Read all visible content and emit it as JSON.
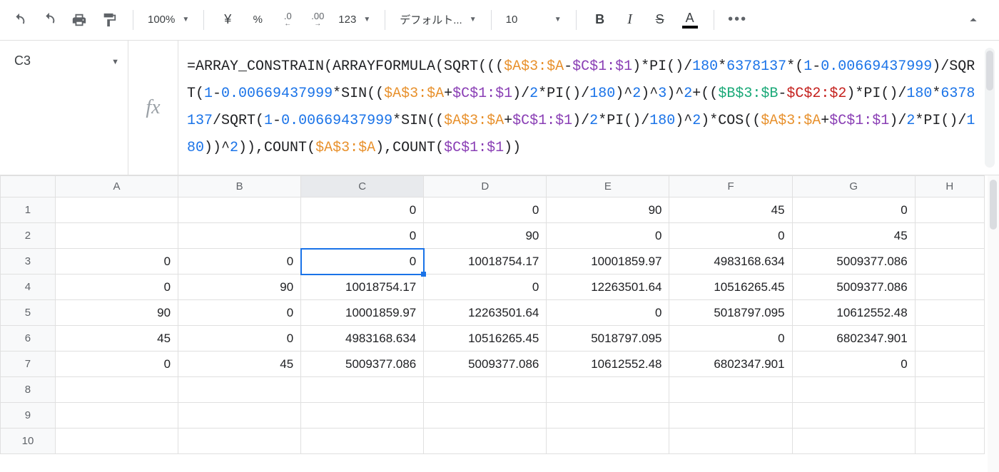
{
  "toolbar": {
    "zoom": "100%",
    "currency_symbol": "¥",
    "percent_label": "%",
    "dec_decrease": ".0",
    "dec_increase": ".00",
    "format_more": "123",
    "font_name": "デフォルト...",
    "font_size": "10",
    "bold": "B",
    "italic": "I",
    "strike": "S",
    "textcolor_letter": "A"
  },
  "namebox": {
    "cell_ref": "C3"
  },
  "fx_label": "fx",
  "formula_tokens": [
    {
      "t": "fn",
      "v": "=ARRAY_CONSTRAIN(ARRAYFORMULA(SQRT((("
    },
    {
      "t": "rngA",
      "v": "$A$3:$A"
    },
    {
      "t": "fn",
      "v": "-"
    },
    {
      "t": "rngC1",
      "v": "$C$1:$1"
    },
    {
      "t": "fn",
      "v": ")*PI()/"
    },
    {
      "t": "num",
      "v": "180"
    },
    {
      "t": "fn",
      "v": "*"
    },
    {
      "t": "num",
      "v": "6378137"
    },
    {
      "t": "fn",
      "v": "*("
    },
    {
      "t": "num",
      "v": "1"
    },
    {
      "t": "fn",
      "v": "-"
    },
    {
      "t": "num",
      "v": "0.00669437999"
    },
    {
      "t": "fn",
      "v": ")/SQRT("
    },
    {
      "t": "num",
      "v": "1"
    },
    {
      "t": "fn",
      "v": "-"
    },
    {
      "t": "num",
      "v": "0.00669437999"
    },
    {
      "t": "fn",
      "v": "*SIN(("
    },
    {
      "t": "rngA",
      "v": "$A$3:$A"
    },
    {
      "t": "fn",
      "v": "+"
    },
    {
      "t": "rngC1",
      "v": "$C$1:$1"
    },
    {
      "t": "fn",
      "v": ")/"
    },
    {
      "t": "num",
      "v": "2"
    },
    {
      "t": "fn",
      "v": "*PI()/"
    },
    {
      "t": "num",
      "v": "180"
    },
    {
      "t": "fn",
      "v": ")^"
    },
    {
      "t": "num",
      "v": "2"
    },
    {
      "t": "fn",
      "v": ")^"
    },
    {
      "t": "num",
      "v": "3"
    },
    {
      "t": "fn",
      "v": ")^"
    },
    {
      "t": "num",
      "v": "2"
    },
    {
      "t": "fn",
      "v": "+(("
    },
    {
      "t": "rngB",
      "v": "$B$3:$B"
    },
    {
      "t": "fn",
      "v": "-"
    },
    {
      "t": "rngC2",
      "v": "$C$2:$2"
    },
    {
      "t": "fn",
      "v": ")*PI()/"
    },
    {
      "t": "num",
      "v": "180"
    },
    {
      "t": "fn",
      "v": "*"
    },
    {
      "t": "num",
      "v": "6378137"
    },
    {
      "t": "fn",
      "v": "/SQRT("
    },
    {
      "t": "num",
      "v": "1"
    },
    {
      "t": "fn",
      "v": "-"
    },
    {
      "t": "num",
      "v": "0.00669437999"
    },
    {
      "t": "fn",
      "v": "*SIN(("
    },
    {
      "t": "rngA",
      "v": "$A$3:$A"
    },
    {
      "t": "fn",
      "v": "+"
    },
    {
      "t": "rngC1",
      "v": "$C$1:$1"
    },
    {
      "t": "fn",
      "v": ")/"
    },
    {
      "t": "num",
      "v": "2"
    },
    {
      "t": "fn",
      "v": "*PI()/"
    },
    {
      "t": "num",
      "v": "180"
    },
    {
      "t": "fn",
      "v": ")^"
    },
    {
      "t": "num",
      "v": "2"
    },
    {
      "t": "fn",
      "v": ")*COS(("
    },
    {
      "t": "rngA",
      "v": "$A$3:$A"
    },
    {
      "t": "fn",
      "v": "+"
    },
    {
      "t": "rngC1",
      "v": "$C$1:$1"
    },
    {
      "t": "fn",
      "v": ")/"
    },
    {
      "t": "num",
      "v": "2"
    },
    {
      "t": "fn",
      "v": "*PI()/"
    },
    {
      "t": "num",
      "v": "180"
    },
    {
      "t": "fn",
      "v": "))^"
    },
    {
      "t": "num",
      "v": "2"
    },
    {
      "t": "fn",
      "v": ")),COUNT("
    },
    {
      "t": "rngA",
      "v": "$A$3:$A"
    },
    {
      "t": "fn",
      "v": "),COUNT("
    },
    {
      "t": "rngC1",
      "v": "$C$1:$1"
    },
    {
      "t": "fn",
      "v": "))"
    }
  ],
  "grid": {
    "columns": [
      "A",
      "B",
      "C",
      "D",
      "E",
      "F",
      "G",
      "H"
    ],
    "row_labels": [
      "1",
      "2",
      "3",
      "4",
      "5",
      "6",
      "7",
      "8",
      "9",
      "10"
    ],
    "selected_cell": "C3",
    "rows": [
      {
        "A": "",
        "B": "",
        "C": "0",
        "D": "0",
        "E": "90",
        "F": "45",
        "G": "0",
        "H": ""
      },
      {
        "A": "",
        "B": "",
        "C": "0",
        "D": "90",
        "E": "0",
        "F": "0",
        "G": "45",
        "H": ""
      },
      {
        "A": "0",
        "B": "0",
        "C": "0",
        "D": "10018754.17",
        "E": "10001859.97",
        "F": "4983168.634",
        "G": "5009377.086",
        "H": ""
      },
      {
        "A": "0",
        "B": "90",
        "C": "10018754.17",
        "D": "0",
        "E": "12263501.64",
        "F": "10516265.45",
        "G": "5009377.086",
        "H": ""
      },
      {
        "A": "90",
        "B": "0",
        "C": "10001859.97",
        "D": "12263501.64",
        "E": "0",
        "F": "5018797.095",
        "G": "10612552.48",
        "H": ""
      },
      {
        "A": "45",
        "B": "0",
        "C": "4983168.634",
        "D": "10516265.45",
        "E": "5018797.095",
        "F": "0",
        "G": "6802347.901",
        "H": ""
      },
      {
        "A": "0",
        "B": "45",
        "C": "5009377.086",
        "D": "5009377.086",
        "E": "10612552.48",
        "F": "6802347.901",
        "G": "0",
        "H": ""
      },
      {
        "A": "",
        "B": "",
        "C": "",
        "D": "",
        "E": "",
        "F": "",
        "G": "",
        "H": ""
      },
      {
        "A": "",
        "B": "",
        "C": "",
        "D": "",
        "E": "",
        "F": "",
        "G": "",
        "H": ""
      },
      {
        "A": "",
        "B": "",
        "C": "",
        "D": "",
        "E": "",
        "F": "",
        "G": "",
        "H": ""
      }
    ]
  }
}
